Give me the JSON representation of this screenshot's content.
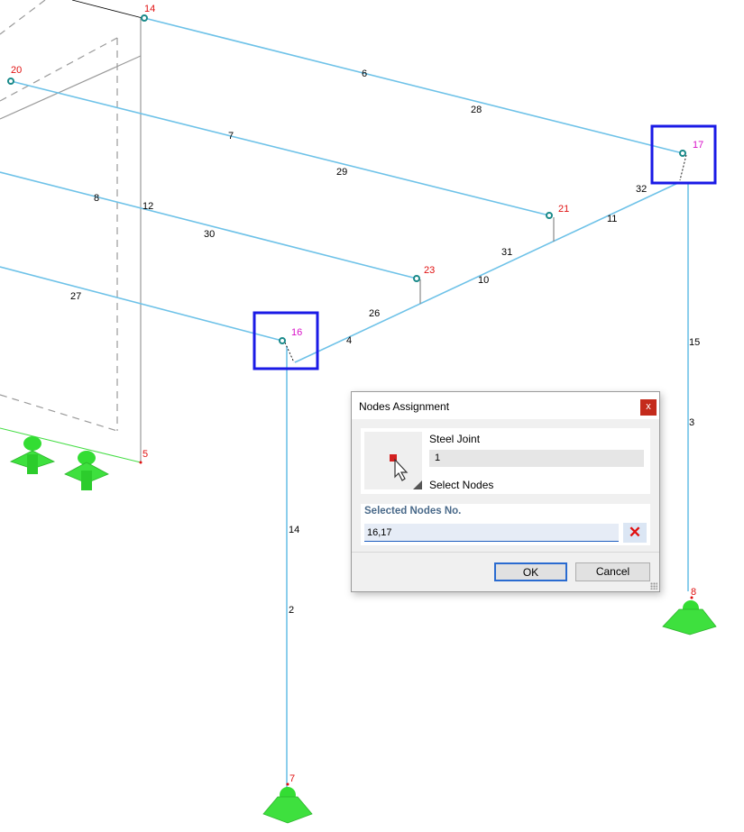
{
  "model": {
    "node_labels": {
      "n14": "14",
      "n20": "20",
      "n21": "21",
      "n23": "23",
      "n16": "16",
      "n17": "17",
      "n5": "5",
      "n7": "7",
      "n8": "8"
    },
    "member_labels": {
      "m6": "6",
      "m28": "28",
      "m7": "7",
      "m29": "29",
      "m8": "8",
      "m12": "12",
      "m30": "30",
      "m32": "32",
      "m11": "11",
      "m31": "31",
      "m10": "10",
      "m27": "27",
      "m26": "26",
      "m4": "4",
      "m15": "15",
      "m3": "3",
      "m14": "14",
      "m2": "2"
    },
    "colors": {
      "member": "#6ec2e8",
      "node_label": "#e01010",
      "selected_node_label": "#d80fc8",
      "selection_box": "#1a1ae6",
      "support": "#33dd33",
      "member_label": "#000000"
    }
  },
  "dialog": {
    "title": "Nodes Assignment",
    "close_label": "x",
    "object_type": "Steel Joint",
    "object_number": "1",
    "select_nodes_label": "Select Nodes",
    "selected_nodes_label": "Selected Nodes No.",
    "selected_nodes_value": "16,17",
    "clear_icon": "x-icon",
    "ok_label": "OK",
    "cancel_label": "Cancel"
  }
}
